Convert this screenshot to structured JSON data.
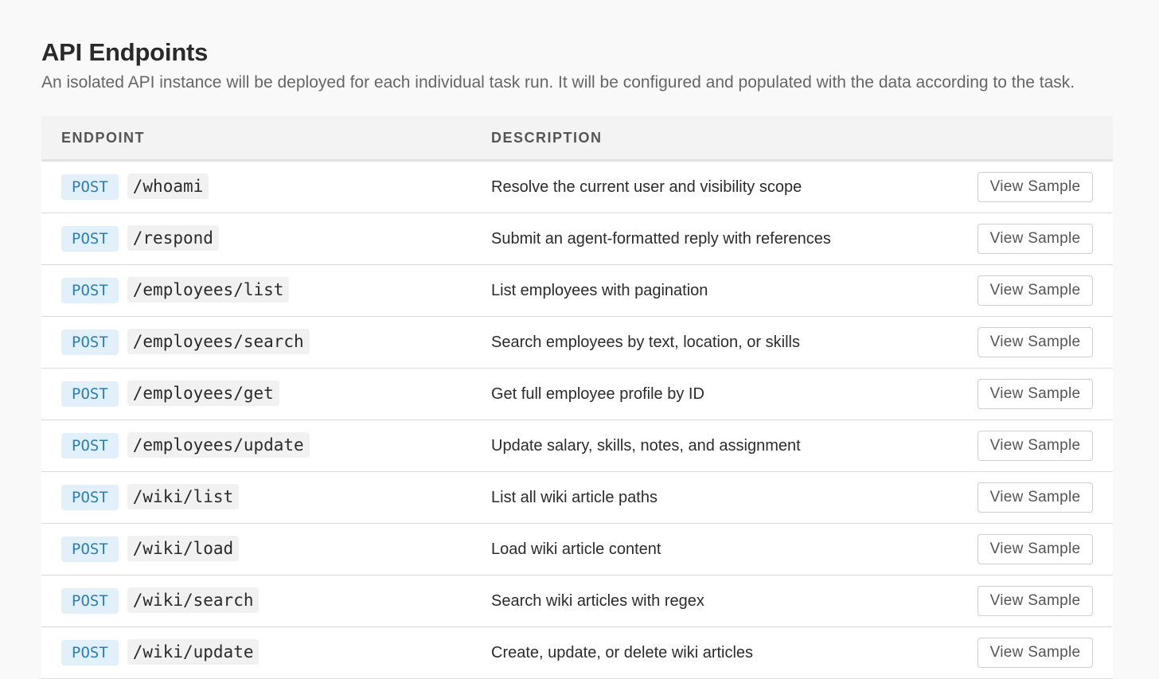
{
  "header": {
    "title": "API Endpoints",
    "subtitle": "An isolated API instance will be deployed for each individual task run. It will be configured and populated with the data according to the task."
  },
  "table": {
    "columns": {
      "endpoint": "ENDPOINT",
      "description": "DESCRIPTION"
    },
    "rows": [
      {
        "method": "POST",
        "path": "/whoami",
        "description": "Resolve the current user and visibility scope",
        "action": "View Sample"
      },
      {
        "method": "POST",
        "path": "/respond",
        "description": "Submit an agent-formatted reply with references",
        "action": "View Sample"
      },
      {
        "method": "POST",
        "path": "/employees/list",
        "description": "List employees with pagination",
        "action": "View Sample"
      },
      {
        "method": "POST",
        "path": "/employees/search",
        "description": "Search employees by text, location, or skills",
        "action": "View Sample"
      },
      {
        "method": "POST",
        "path": "/employees/get",
        "description": "Get full employee profile by ID",
        "action": "View Sample"
      },
      {
        "method": "POST",
        "path": "/employees/update",
        "description": "Update salary, skills, notes, and assignment",
        "action": "View Sample"
      },
      {
        "method": "POST",
        "path": "/wiki/list",
        "description": "List all wiki article paths",
        "action": "View Sample"
      },
      {
        "method": "POST",
        "path": "/wiki/load",
        "description": "Load wiki article content",
        "action": "View Sample"
      },
      {
        "method": "POST",
        "path": "/wiki/search",
        "description": "Search wiki articles with regex",
        "action": "View Sample"
      },
      {
        "method": "POST",
        "path": "/wiki/update",
        "description": "Create, update, or delete wiki articles",
        "action": "View Sample"
      }
    ]
  },
  "colors": {
    "method_bg": "#e1f0fb",
    "method_text": "#2c7db8",
    "page_bg": "#f9f9f9"
  }
}
